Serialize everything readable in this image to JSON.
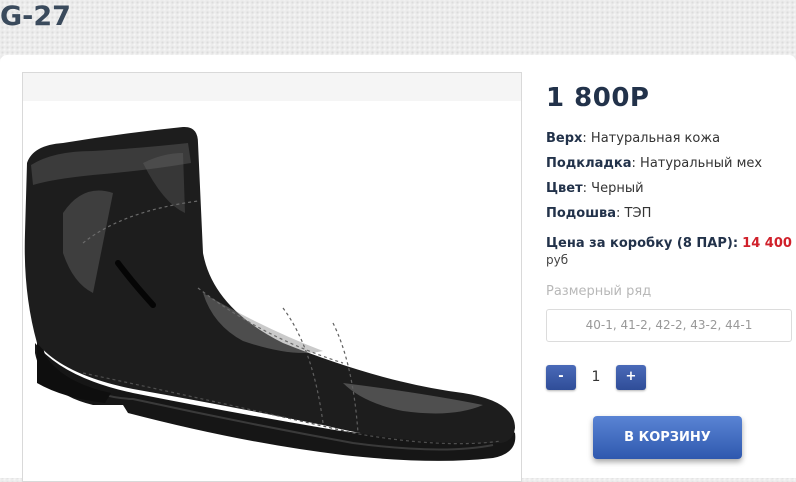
{
  "product": {
    "title": "G-27",
    "image_alt": "Черный кожаный ботинок",
    "price": "1 800Р",
    "specs": [
      {
        "label": "Верх",
        "value": ": Натуральная кожа"
      },
      {
        "label": "Подкладка",
        "value": ": Натуральный мех"
      },
      {
        "label": "Цвет",
        "value": ": Черный"
      },
      {
        "label": "Подошва",
        "value": ": ТЭП"
      }
    ],
    "box_price": {
      "label": "Цена за коробку (8 ПАР):",
      "value": "14 400",
      "unit": "руб"
    },
    "size_range": {
      "label": "Размерный ряд",
      "value": "40-1, 41-2, 42-2, 43-2, 44-1"
    },
    "quantity": {
      "minus_label": "-",
      "value": "1",
      "plus_label": "+"
    },
    "cart_button_label": "В КОРЗИНУ"
  },
  "colors": {
    "accent_button": "#3a5ca8",
    "price_highlight": "#d0202a",
    "heading": "#22324a"
  }
}
